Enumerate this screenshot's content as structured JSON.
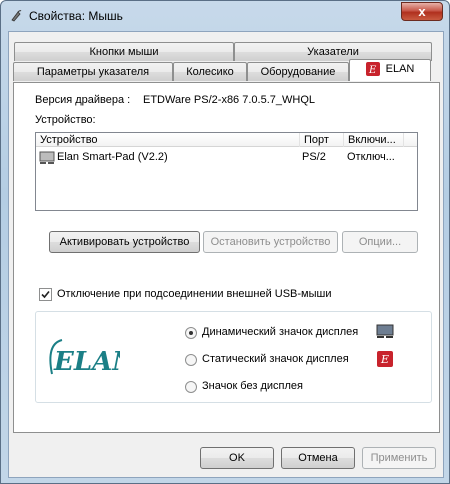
{
  "window": {
    "title": "Свойства: Мышь",
    "close_label": "x"
  },
  "tabs": {
    "row1": [
      "Кнопки мыши",
      "Указатели"
    ],
    "row2": [
      "Параметры указателя",
      "Колесико",
      "Оборудование",
      "ELAN"
    ],
    "active": "ELAN"
  },
  "driver": {
    "label": "Версия драйвера :",
    "value": "ETDWare PS/2-x86 7.0.5.7_WHQL"
  },
  "devices": {
    "label": "Устройство:",
    "columns": [
      "Устройство",
      "Порт",
      "Включи..."
    ],
    "rows": [
      {
        "name": "Elan Smart-Pad  (V2.2)",
        "port": "PS/2",
        "enabled": "Отключ..."
      }
    ]
  },
  "buttons": {
    "activate": "Активировать устройство",
    "stop": "Остановить устройство",
    "options": "Опции..."
  },
  "usb_checkbox": {
    "label": "Отключение при подсоединении внешней USB-мыши",
    "checked": true
  },
  "logo_text": "ELAN",
  "display_options": [
    {
      "label": "Динамический значок дисплея",
      "checked": true,
      "icon": "monitor-icon"
    },
    {
      "label": "Статический значок дисплея",
      "checked": false,
      "icon": "elan-red-icon"
    },
    {
      "label": "Значок без дисплея",
      "checked": false,
      "icon": ""
    }
  ],
  "footer": {
    "ok": "OK",
    "cancel": "Отмена",
    "apply": "Применить"
  },
  "colors": {
    "accent_red": "#c8232c",
    "logo_teal": "#1b7f86"
  }
}
